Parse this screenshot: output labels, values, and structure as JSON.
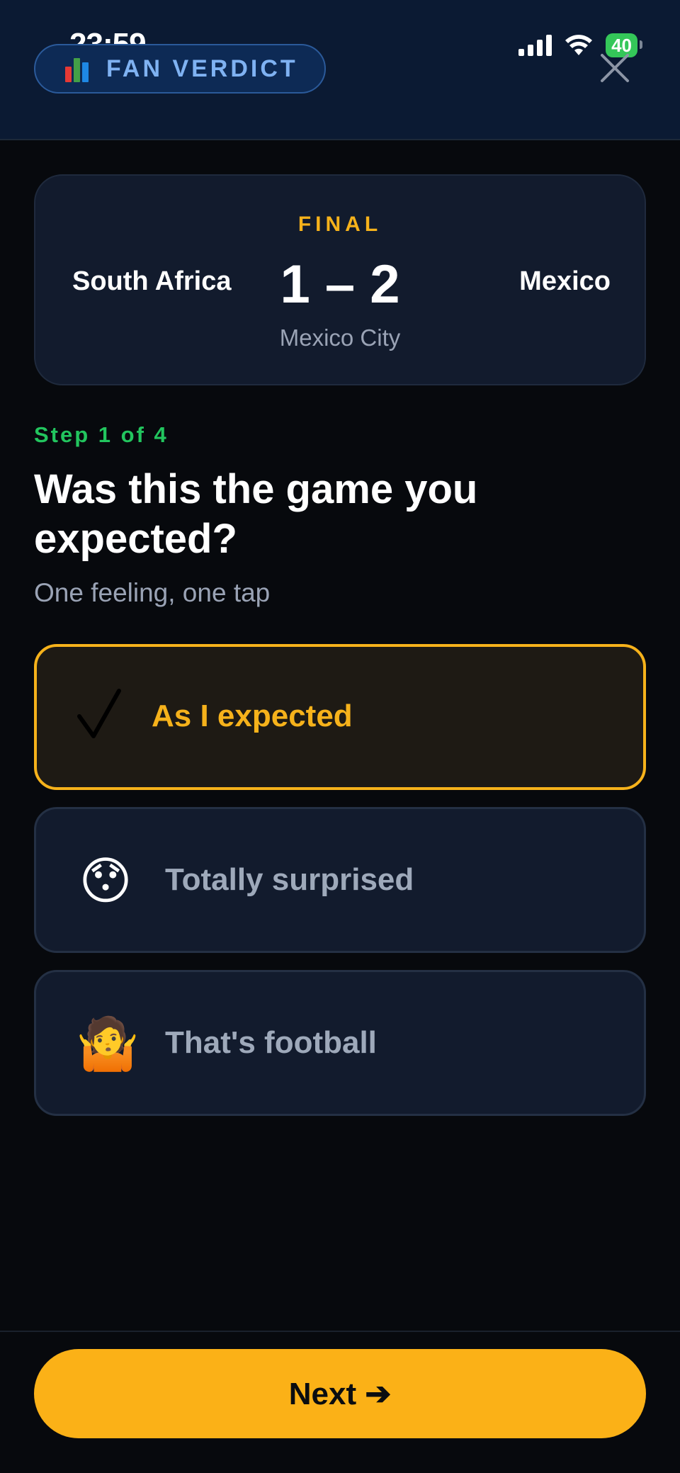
{
  "status_bar": {
    "time": "23:59",
    "battery": "40"
  },
  "header": {
    "badge_label": "FAN VERDICT"
  },
  "match": {
    "status": "FINAL",
    "home_team": "South Africa",
    "away_team": "Mexico",
    "score": "1 – 2",
    "venue": "Mexico City"
  },
  "step": {
    "label": "Step 1 of 4"
  },
  "question": {
    "title": "Was this the game you expected?",
    "subtitle": "One feeling, one tap"
  },
  "options": [
    {
      "label": "As I expected",
      "icon": "checkmark-icon",
      "selected": true
    },
    {
      "label": "Totally surprised",
      "icon": "😯",
      "selected": false
    },
    {
      "label": "That's football",
      "icon": "🤷",
      "selected": false
    }
  ],
  "footer": {
    "next_label": "Next ➔"
  },
  "colors": {
    "accent": "#f6b21b",
    "step": "#22c55e",
    "header_bg": "#0b1a33"
  }
}
